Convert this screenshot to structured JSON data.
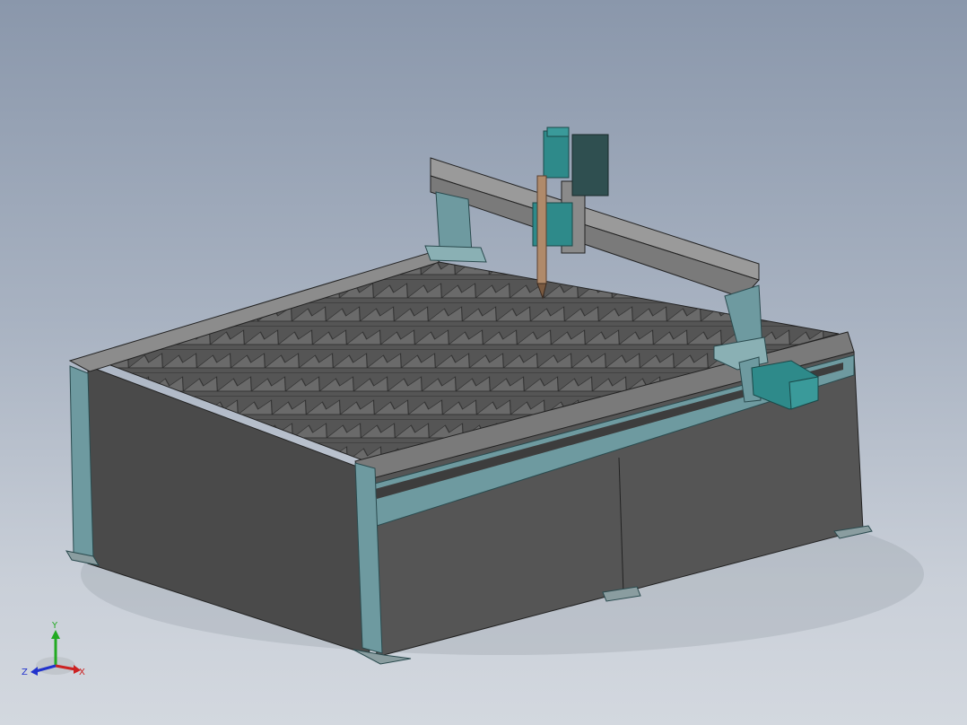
{
  "viewport": {
    "background_top": "#8a97ab",
    "background_bottom": "#d3d8df"
  },
  "model": {
    "name": "cnc-plasma-cutting-table",
    "colors": {
      "frame": "#6e9aa0",
      "frame_dark": "#4f7a80",
      "panel": "#4d4d4d",
      "panel_dark": "#3a3a3a",
      "slats": "#5a5a5a",
      "rail": "#8a8a8a",
      "motor": "#2e8a8a",
      "torch": "#b08a6a"
    }
  },
  "triad": {
    "x_label": "X",
    "y_label": "Y",
    "z_label": "Z",
    "x_color": "#cc2222",
    "y_color": "#22aa22",
    "z_color": "#2233cc"
  }
}
